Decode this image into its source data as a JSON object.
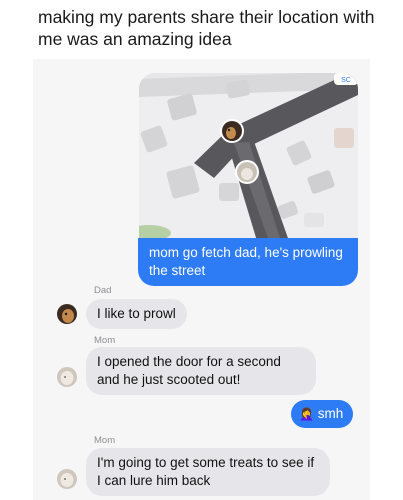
{
  "caption": "making my parents share their location with me was an amazing idea",
  "map": {
    "corner_text": "SC"
  },
  "messages": [
    {
      "sender": "me",
      "text": "mom go fetch dad, he's prowling the street"
    },
    {
      "sender": "Dad",
      "label": "Dad",
      "text": "I like to prowl"
    },
    {
      "sender": "Mom",
      "label": "Mom",
      "text": "I opened the door for a second and he just scooted out!"
    },
    {
      "sender": "me",
      "emoji": "🤦‍♀️",
      "text": "smh"
    },
    {
      "sender": "Mom",
      "label": "Mom",
      "text": "I'm going to get some treats to see if I can lure him back"
    }
  ],
  "colors": {
    "sent_bubble": "#2d7cf6",
    "received_bubble": "#e6e6ea",
    "chat_background": "#f6f6f6"
  }
}
